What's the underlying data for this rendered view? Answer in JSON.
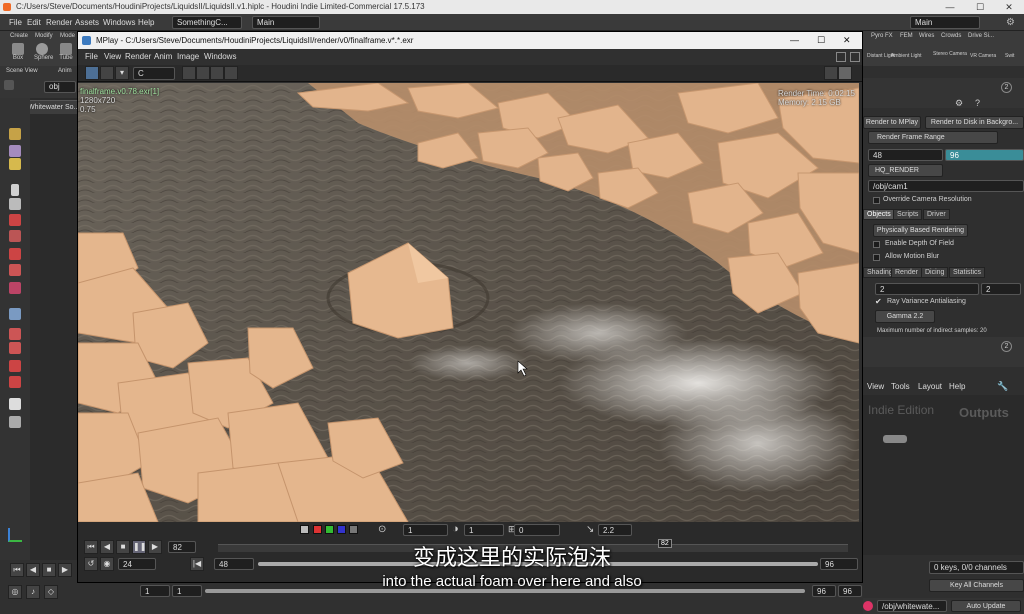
{
  "main_window": {
    "title": "C:/Users/Steve/Documents/HoudiniProjects/LiquidsII/LiquidsII.v1.hiplc - Houdini Indie Limited-Commercial 17.5.173",
    "minimize": "—",
    "maximize": "☐",
    "close": "✕"
  },
  "main_menu": {
    "items": [
      "File",
      "Edit",
      "Render",
      "Assets",
      "Windows",
      "Help"
    ],
    "desktop": "SomethingC...",
    "desktop_right": "Main",
    "network_tab": "Main"
  },
  "shelf": {
    "tabs": [
      "Create",
      "Modify",
      "Mode"
    ],
    "tools": [
      "Box",
      "Sphere",
      "Tube"
    ],
    "right_tabs": [
      "Pyro FX",
      "FEM",
      "Wires",
      "Crowds",
      "Drive Si..."
    ],
    "right_tools": [
      "Distant Light",
      "Ambient Light",
      "Stereo Camera",
      "VR Camera",
      "Swit"
    ]
  },
  "scene_view": {
    "tab": "Scene View",
    "tab2": "Anim",
    "path": "obj",
    "viewer_label": "Whitewater So..."
  },
  "mplay": {
    "title": "MPlay - C:/Users/Steve/Documents/HoudiniProjects/LiquidsII/render/v0/finalframe.v*.*.exr",
    "menu": [
      "File",
      "View",
      "Render",
      "Anim",
      "Image",
      "Windows"
    ],
    "channel": "C",
    "image_info_1": "finalframe.v0.78.exr[1]",
    "image_info_2": "1280x720",
    "image_info_3": "0.75",
    "render_time": "Render Time: 0:02:15",
    "memory": "Memory:        2.15 GB",
    "exposure_value": "1",
    "gamma_value": "1",
    "lut_value": "0",
    "gamma_field": "2.2",
    "frame_current": "82",
    "frame_step": "24",
    "range_start": "48",
    "range_end": "96",
    "frame_marker": "82"
  },
  "render_node": {
    "render_to_mplay": "Render to MPlay",
    "render_to_disk": "Render to Disk in Backgro...",
    "render_frame_range": "Render Frame Range",
    "start": "48",
    "end": "96",
    "render_node": "HQ_RENDER",
    "camera": "/obj/cam1",
    "override_camera": "Override Camera Resolution",
    "tabs": [
      "Objects",
      "Scripts",
      "Driver"
    ],
    "pbr": "Physically Based Rendering",
    "dof": "Enable Depth Of Field",
    "motion_blur": "Allow Motion Blur",
    "sub_tabs": [
      "Shading",
      "Render",
      "Dicing",
      "Statistics"
    ],
    "samples_a": "2",
    "samples_b": "2",
    "ray_variance": "Ray Variance Antialiasing",
    "gamma": "Gamma 2.2",
    "max_indirect": "Maximum number of indirect samples: 20"
  },
  "network": {
    "menu": [
      "View",
      "Tools",
      "Layout",
      "Help"
    ],
    "watermark": "Indie Edition",
    "outputs": "Outputs"
  },
  "timeline_right": {
    "keys": "0 keys, 0/0 channels",
    "key_all": "Key All Channels",
    "path": "/obj/whitewate...",
    "auto_update": "Auto Update",
    "start": "1",
    "end_a": "96",
    "end_b": "96",
    "current": "1"
  },
  "subtitles": {
    "chinese": "变成这里的实际泡沫",
    "english": "into the actual foam over here and also"
  },
  "colors": {
    "accent_teal": "#3a8d98",
    "rock": "#e2b48c",
    "water": "#5e564d"
  }
}
